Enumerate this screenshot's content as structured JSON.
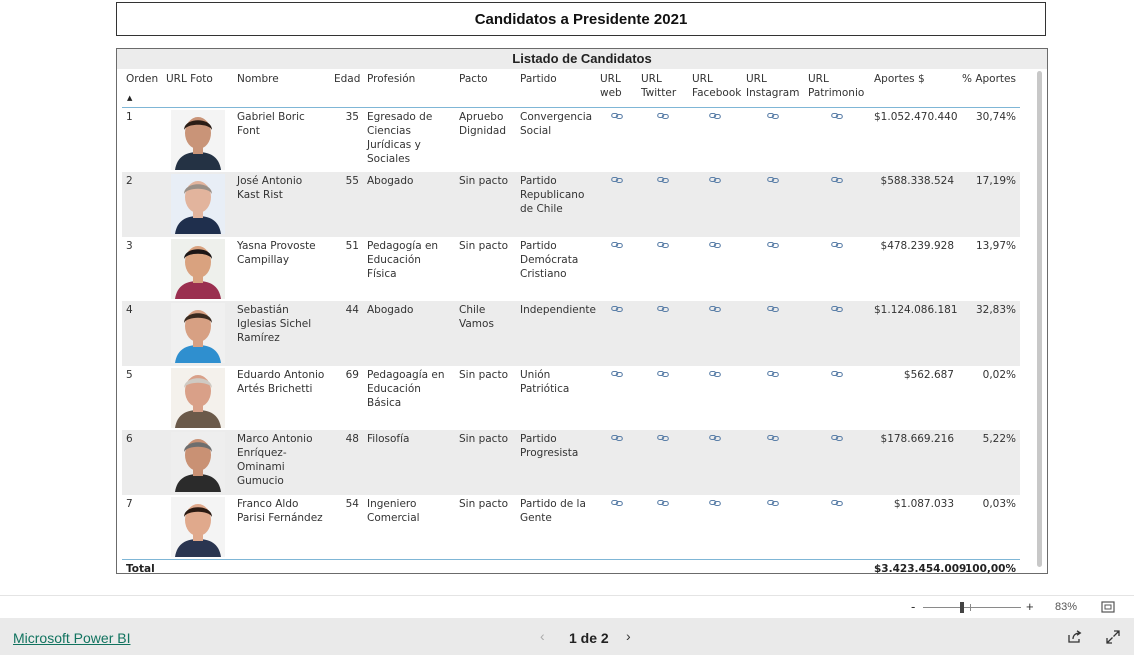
{
  "report": {
    "title": "Candidatos a Presidente 2021"
  },
  "table": {
    "title": "Listado de Candidatos",
    "headers": {
      "orden": "Orden",
      "foto": "URL Foto",
      "nombre": "Nombre",
      "edad": "Edad",
      "profesion": "Profesión",
      "pacto": "Pacto",
      "partido": "Partido",
      "web": "URL web",
      "twitter": "URL Twitter",
      "facebook": "URL Facebook",
      "instagram": "URL Instagram",
      "patrimonio": "URL Patrimonio",
      "aportes": "Aportes $",
      "pct": "% Aportes"
    },
    "sort_indicator": "▲",
    "rows": [
      {
        "orden": "1",
        "nombre": "Gabriel Boric Font",
        "edad": "35",
        "profesion": "Egresado de Ciencias Jurídicas y Sociales",
        "pacto": "Apruebo Dignidad",
        "partido": "Convergencia Social",
        "aportes": "$1.052.470.440",
        "pct": "30,74%"
      },
      {
        "orden": "2",
        "nombre": "José Antonio Kast Rist",
        "edad": "55",
        "profesion": "Abogado",
        "pacto": "Sin pacto",
        "partido": "Partido Republicano de Chile",
        "aportes": "$588.338.524",
        "pct": "17,19%"
      },
      {
        "orden": "3",
        "nombre": "Yasna Provoste Campillay",
        "edad": "51",
        "profesion": "Pedagogía en Educación Física",
        "pacto": "Sin pacto",
        "partido": "Partido Demócrata Cristiano",
        "aportes": "$478.239.928",
        "pct": "13,97%"
      },
      {
        "orden": "4",
        "nombre": "Sebastián Iglesias Sichel Ramírez",
        "edad": "44",
        "profesion": "Abogado",
        "pacto": "Chile Vamos",
        "partido": "Independiente",
        "aportes": "$1.124.086.181",
        "pct": "32,83%"
      },
      {
        "orden": "5",
        "nombre": "Eduardo Antonio Artés Brichetti",
        "edad": "69",
        "profesion": "Pedagoagía en Educación Básica",
        "pacto": "Sin pacto",
        "partido": "Unión Patriótica",
        "aportes": "$562.687",
        "pct": "0,02%"
      },
      {
        "orden": "6",
        "nombre": "Marco Antonio Enríquez-Ominami Gumucio",
        "edad": "48",
        "profesion": "Filosofía",
        "pacto": "Sin pacto",
        "partido": "Partido Progresista",
        "aportes": "$178.669.216",
        "pct": "5,22%"
      },
      {
        "orden": "7",
        "nombre": "Franco Aldo Parisi Fernández",
        "edad": "54",
        "profesion": "Ingeniero Comercial",
        "pacto": "Sin pacto",
        "partido": "Partido de la Gente",
        "aportes": "$1.087.033",
        "pct": "0,03%"
      }
    ],
    "total": {
      "label": "Total",
      "aportes": "$3.423.454.009",
      "pct": "100,00%"
    }
  },
  "zoom": {
    "minus": "-",
    "plus": "+",
    "level": "83%"
  },
  "footer": {
    "brand": "Microsoft Power BI",
    "prev": "‹",
    "page_text": "1 de 2",
    "next": "›"
  },
  "colors": {
    "header_line": "#7fb6d6",
    "row_shade": "#ececec",
    "link_icon": "#5b7fa8",
    "brand_link": "#11735f"
  },
  "icons": [
    "link-icon",
    "person-photo",
    "fit-to-page-icon",
    "share-icon",
    "expand-icon",
    "zoom-slider"
  ],
  "photo_tones": [
    {
      "skin": "#c99478",
      "hair": "#2a1d16",
      "shirt": "#243244",
      "bg": "#f4f4f4"
    },
    {
      "skin": "#e2b49d",
      "hair": "#9a8f86",
      "shirt": "#1f2f4d",
      "bg": "#e8eef6"
    },
    {
      "skin": "#d9a27f",
      "hair": "#1c1616",
      "shirt": "#9a2f4f",
      "bg": "#eef0ec"
    },
    {
      "skin": "#d7a083",
      "hair": "#3a2a20",
      "shirt": "#2f8fcf",
      "bg": "#f0f0f0"
    },
    {
      "skin": "#d9a088",
      "hair": "#cfcac3",
      "shirt": "#6b5a4a",
      "bg": "#f4f1ec"
    },
    {
      "skin": "#c99174",
      "hair": "#6e6e6e",
      "shirt": "#2b2b2b",
      "bg": "#eeeeee"
    },
    {
      "skin": "#e0a98c",
      "hair": "#2b1a12",
      "shirt": "#2a3550",
      "bg": "#f4f4f4"
    }
  ]
}
